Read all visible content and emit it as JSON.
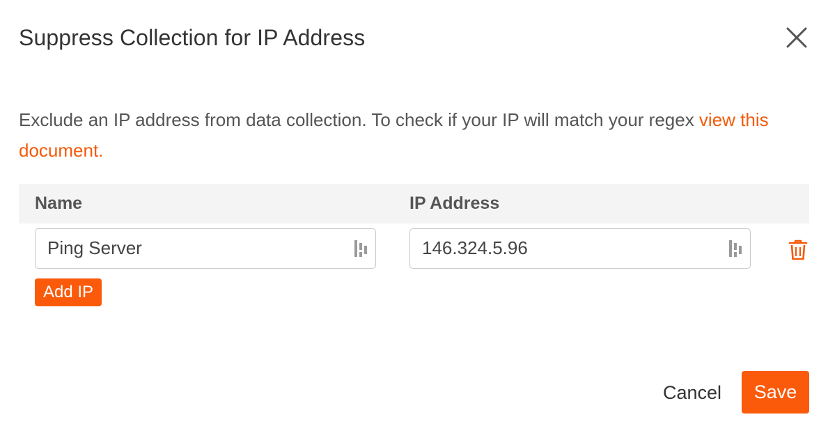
{
  "dialog": {
    "title": "Suppress Collection for IP Address",
    "description": "Exclude an IP address from data collection. To check if your IP will match your regex ",
    "link_text": "view this document."
  },
  "table": {
    "columns": [
      "Name",
      "IP Address"
    ],
    "rows": [
      {
        "name": "Ping Server",
        "ip": "146.324.5.96"
      }
    ]
  },
  "buttons": {
    "add_ip": "Add IP",
    "cancel": "Cancel",
    "save": "Save"
  },
  "icons": {
    "close": "close-icon",
    "trash": "trash-icon",
    "password_manager": "password-manager-icon"
  },
  "colors": {
    "accent": "#fa5a0a",
    "header_bg": "#f4f4f4"
  }
}
